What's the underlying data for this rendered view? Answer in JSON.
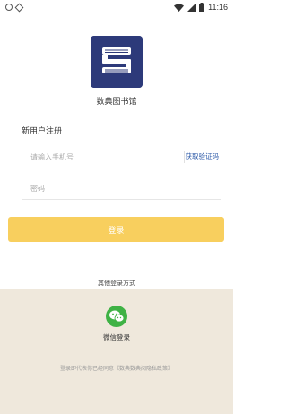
{
  "status_bar": {
    "time": "11:16",
    "left_icons": [
      "circle-icon",
      "diamond-icon"
    ],
    "right_icons": [
      "wifi-icon",
      "signal-icon",
      "battery-icon"
    ]
  },
  "app": {
    "name": "数典图书馆",
    "logo_color": "#2d3a7a"
  },
  "form": {
    "section_title": "新用户注册",
    "phone_placeholder": "请输入手机号",
    "get_code_label": "获取验证码",
    "password_placeholder": "密码",
    "login_label": "登录"
  },
  "alt_login": {
    "title": "其他登录方式",
    "wechat_label": "微信登录"
  },
  "agreement": {
    "text": "登录即代表你已经同意",
    "link": "《数典数典阅隐私政策》"
  },
  "colors": {
    "accent": "#f8cf5e",
    "link": "#2d5aa8",
    "wechat": "#3fb245",
    "panel_bg": "#efe8dc"
  }
}
